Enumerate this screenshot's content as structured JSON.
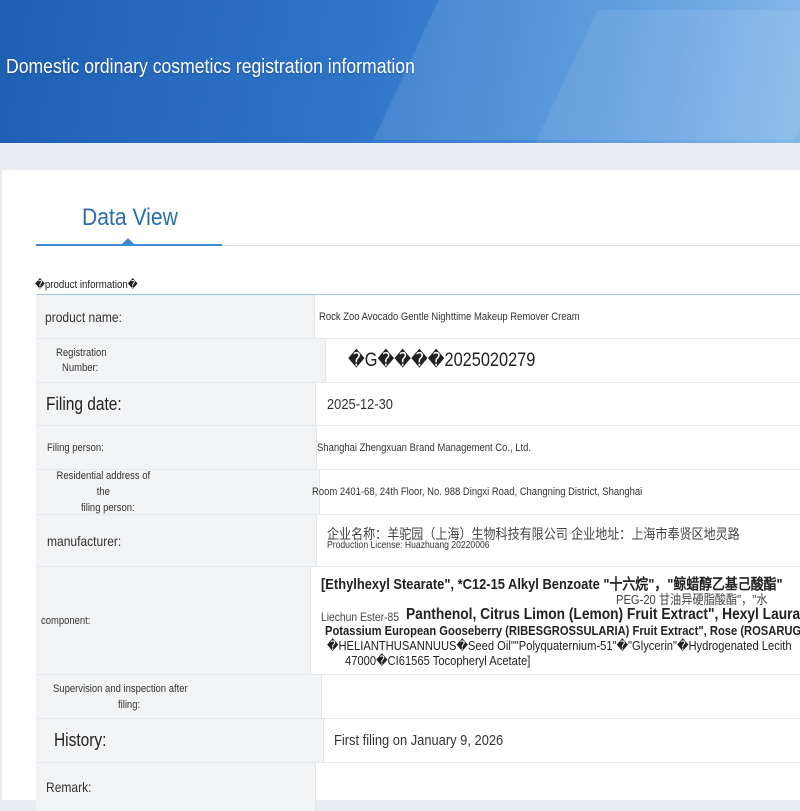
{
  "banner": {
    "title": "Domestic ordinary cosmetics registration information"
  },
  "tab": {
    "label": "Data View"
  },
  "section": {
    "heading": "�product information�"
  },
  "fields": {
    "product_name": {
      "label": "product name:",
      "value": "Rock Zoo Avocado Gentle Nighttime Makeup Remover Cream"
    },
    "registration_number": {
      "label_line1": "Registration",
      "label_line2": "Number:",
      "value": "�G����2025020279"
    },
    "filing_date": {
      "label": "Filing date:",
      "value": "2025-12-30"
    },
    "filing_person": {
      "label": "Filing person:",
      "value": "Shanghai Zhengxuan Brand Management Co., Ltd."
    },
    "residential_address": {
      "label_line1": "Residential address of the",
      "label_line2": "filing person:",
      "value": "Room 2401-68, 24th Floor, No. 988 Dingxi Road, Changning District, Shanghai"
    },
    "manufacturer": {
      "label": "manufacturer:",
      "value_line1": "企业名称：羊驼园（上海）生物科技有限公司 企业地址：上海市奉贤区地灵路",
      "value_line2": "Production License: Huazhuang 20220006"
    },
    "component": {
      "label": "component:",
      "line1": "[Ethylhexyl Stearate\", *C12-15 Alkyl Benzoate  \"十六烷\"，\"鲸蜡醇乙基己酸酯\"",
      "line2": "PEG-20 甘油异硬脂酸酯\"，\"水",
      "line3": "Liechun Ester-85",
      "line3b": "Panthenol, Citrus Limon (Lemon) Fruit Extract\", Hexyl Laurate",
      "line4": "Potassium European Gooseberry (RIBESGROSSULARIA) Fruit Extract\", Rose (ROSARUGO",
      "line5": "�HELIANTHUSANNUUS�Seed Oil\"\"Polyquaternium-51\"�\"Glycerin\"�Hydrogenated Lecith",
      "line6": "47000�CI61565 Tocopheryl Acetate]"
    },
    "supervision": {
      "label_line1": "Supervision and inspection after",
      "label_line2": "filing:",
      "value": ""
    },
    "history": {
      "label": "History:",
      "value": "First filing on January 9, 2026"
    },
    "remark": {
      "label": "Remark:",
      "value": ""
    }
  }
}
